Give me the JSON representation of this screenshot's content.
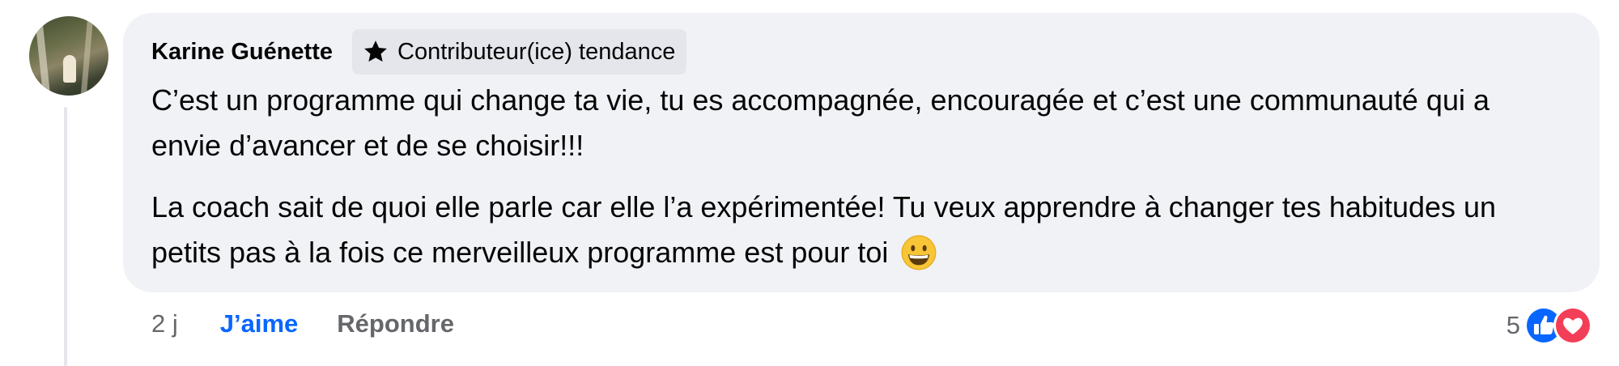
{
  "comment": {
    "author": "Karine Guénette",
    "badge_label": "Contributeur(ice) tendance",
    "paragraph_1": "C’est un programme qui change ta vie, tu es accompagnée, encouragée et c’est une communauté qui a envie d’avancer et de se choisir!!!",
    "paragraph_2": "La coach sait de quoi elle parle car elle l’a expérimentée! Tu veux apprendre à changer tes habitudes un petits pas à la fois ce merveilleux programme est pour toi"
  },
  "actions": {
    "time": "2 j",
    "like_label": "J’aime",
    "reply_label": "Répondre"
  },
  "reactions": {
    "count": "5",
    "icons": [
      "like-icon",
      "love-icon"
    ]
  },
  "colors": {
    "bubble": "#f0f2f5",
    "link_blue": "#0866ff",
    "secondary_text": "#65676b",
    "like_blue": "#0866ff",
    "love_red": "#f33e58"
  }
}
